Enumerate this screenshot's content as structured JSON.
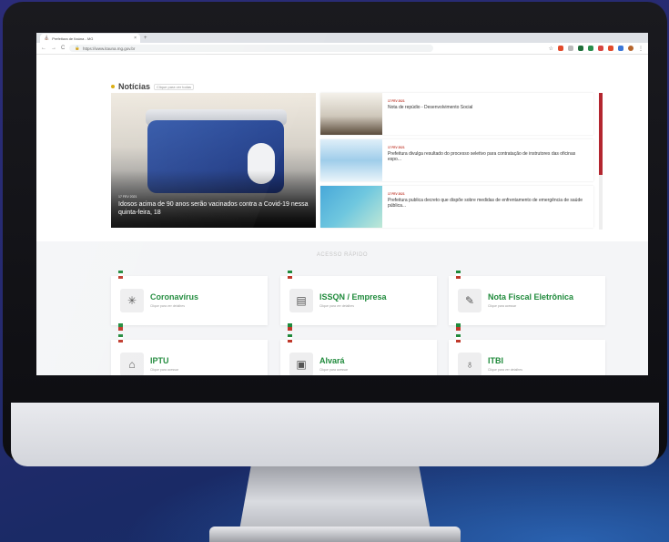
{
  "browser": {
    "tab_title": "Prefeitura de Itaúna - MG",
    "tab_close": "×",
    "new_tab": "+",
    "nav_back": "←",
    "nav_forward": "→",
    "nav_reload": "C",
    "url": "https://www.itauna.mg.gov.br"
  },
  "news": {
    "title": "Notícias",
    "subtitle": "Clique para ver todas",
    "hero": {
      "date": "17 FEV 2021",
      "caption": "Idosos acima de 90 anos serão vacinados contra a Covid-19 nessa quinta-feira, 18"
    },
    "items": [
      {
        "date": "17 FEV 2021",
        "text": "Nota de repúdio - Desenvolvimento Social"
      },
      {
        "date": "17 FEV 2021",
        "text": "Prefeitura divulga resultado do processo seletivo para contratação de instrutores das oficinas espo..."
      },
      {
        "date": "17 FEV 2021",
        "text": "Prefeitura publica decreto que dispõe sobre medidas de enfrentamento de emergência de saúde pública..."
      }
    ]
  },
  "quick_access": {
    "title": "ACESSO RÁPIDO",
    "cards": [
      {
        "label": "Coronavírus",
        "sub": "Clique para ver detalhes",
        "icon": "virus-icon"
      },
      {
        "label": "ISSQN / Empresa",
        "sub": "Clique para ver detalhes",
        "icon": "document-icon"
      },
      {
        "label": "Nota Fiscal Eletrônica",
        "sub": "Clique para acessar",
        "icon": "invoice-icon"
      },
      {
        "label": "IPTU",
        "sub": "Clique para acessar",
        "icon": "house-icon"
      },
      {
        "label": "Alvará",
        "sub": "Clique para acessar",
        "icon": "certificate-icon"
      },
      {
        "label": "ITBI",
        "sub": "Clique para ver detalhes",
        "icon": "money-bag-icon"
      }
    ]
  },
  "colors": {
    "brand_green": "#1f8a3b",
    "brand_red": "#c0392b",
    "accent_yellow": "#d8a800"
  }
}
